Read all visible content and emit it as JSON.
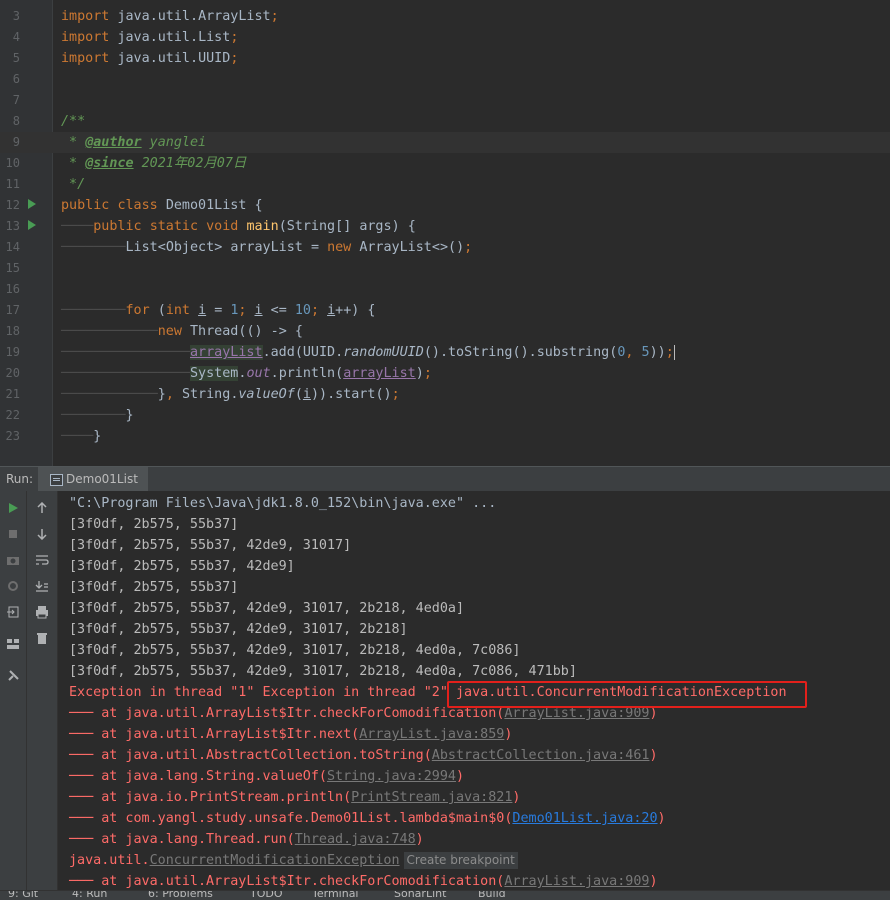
{
  "editor": {
    "lines": [
      {
        "n": "3",
        "t": "import java.util.ArrayList;"
      },
      {
        "n": "4",
        "t": "import java.util.List;"
      },
      {
        "n": "5",
        "t": "import java.util.UUID;"
      },
      {
        "n": "6",
        "t": ""
      },
      {
        "n": "7",
        "t": ""
      },
      {
        "n": "8",
        "t": "/**"
      },
      {
        "n": "9",
        "t": " * @author yanglei"
      },
      {
        "n": "10",
        "t": " * @since 2021年02月07日"
      },
      {
        "n": "11",
        "t": " */"
      },
      {
        "n": "12",
        "t": "public class Demo01List {"
      },
      {
        "n": "13",
        "t": "    public static void main(String[] args) {"
      },
      {
        "n": "14",
        "t": "        List<Object> arrayList = new ArrayList<>();"
      },
      {
        "n": "15",
        "t": ""
      },
      {
        "n": "16",
        "t": ""
      },
      {
        "n": "17",
        "t": "        for (int i = 1; i <= 10; i++) {"
      },
      {
        "n": "18",
        "t": "            new Thread(() -> {"
      },
      {
        "n": "19",
        "t": "                arrayList.add(UUID.randomUUID().toString().substring(0, 5));"
      },
      {
        "n": "20",
        "t": "                System.out.println(arrayList);"
      },
      {
        "n": "21",
        "t": "            }, String.valueOf(i)).start();"
      },
      {
        "n": "22",
        "t": "        }"
      },
      {
        "n": "23",
        "t": "    }"
      }
    ]
  },
  "run_panel": {
    "label": "Run:",
    "tab": "Demo01List"
  },
  "console": {
    "cmd": "\"C:\\Program Files\\Java\\jdk1.8.0_152\\bin\\java.exe\" ...",
    "outputs": [
      "[3f0df, 2b575, 55b37]",
      "[3f0df, 2b575, 55b37, 42de9, 31017]",
      "[3f0df, 2b575, 55b37, 42de9]",
      "[3f0df, 2b575, 55b37]",
      "[3f0df, 2b575, 55b37, 42de9, 31017, 2b218, 4ed0a]",
      "[3f0df, 2b575, 55b37, 42de9, 31017, 2b218]",
      "[3f0df, 2b575, 55b37, 42de9, 31017, 2b218, 4ed0a, 7c086]",
      "[3f0df, 2b575, 55b37, 42de9, 31017, 2b218, 4ed0a, 7c086, 471bb]"
    ],
    "exception_head": "Exception in thread \"1\" Exception in thread \"2\" ",
    "exception_name": "java.util.ConcurrentModificationException",
    "stack": [
      {
        "t": "at java.util.ArrayList$Itr.checkForComodification(",
        "l": "ArrayList.java:909",
        "e": ")"
      },
      {
        "t": "at java.util.ArrayList$Itr.next(",
        "l": "ArrayList.java:859",
        "e": ")"
      },
      {
        "t": "at java.util.AbstractCollection.toString(",
        "l": "AbstractCollection.java:461",
        "e": ")"
      },
      {
        "t": "at java.lang.String.valueOf(",
        "l": "String.java:2994",
        "e": ")"
      },
      {
        "t": "at java.io.PrintStream.println(",
        "l": "PrintStream.java:821",
        "e": ")"
      },
      {
        "t": "at com.yangl.study.unsafe.Demo01List.lambda$main$0(",
        "l": "Demo01List.java:20",
        "e": ")"
      },
      {
        "t": "at java.lang.Thread.run(",
        "l": "Thread.java:748",
        "e": ")"
      }
    ],
    "second_exc_prefix": "java.util.",
    "second_exc_link": "ConcurrentModificationException",
    "create_breakpoint": "Create breakpoint",
    "last_stack": {
      "t": "at java.util.ArrayList$Itr.checkForComodification(",
      "l": "ArrayList.java:909",
      "e": ")"
    }
  },
  "statusbar": {
    "items": [
      "9: Git",
      "4: Run",
      "6: Problems",
      "TODO",
      "Terminal",
      "SonarLint",
      "Build"
    ]
  }
}
